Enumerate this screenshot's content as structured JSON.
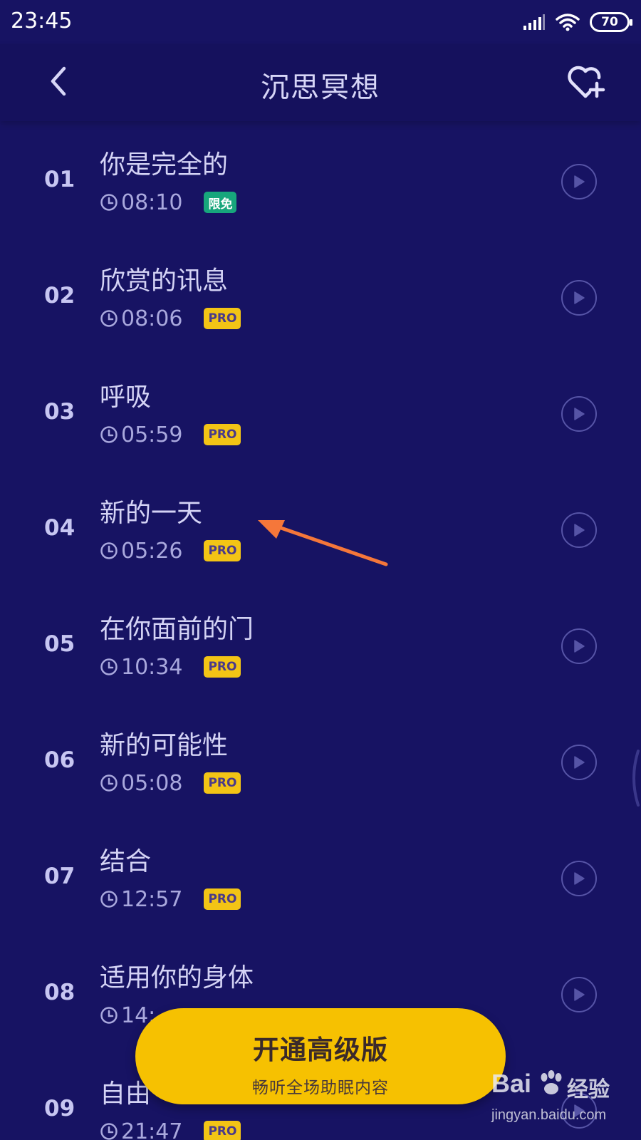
{
  "status_bar": {
    "time": "23:45",
    "battery": "70",
    "icons": [
      "signal-icon",
      "wifi-icon",
      "battery-icon"
    ]
  },
  "header": {
    "title": "沉思冥想",
    "back_icon": "chevron-left-icon",
    "favorite_icon": "heart-plus-icon"
  },
  "tracks": [
    {
      "num": "01",
      "title": "你是完全的",
      "duration": "08:10",
      "badge": "限免"
    },
    {
      "num": "02",
      "title": "欣赏的讯息",
      "duration": "08:06",
      "badge": "PRO"
    },
    {
      "num": "03",
      "title": "呼吸",
      "duration": "05:59",
      "badge": "PRO"
    },
    {
      "num": "04",
      "title": "新的一天",
      "duration": "05:26",
      "badge": "PRO"
    },
    {
      "num": "05",
      "title": "在你面前的门",
      "duration": "10:34",
      "badge": "PRO"
    },
    {
      "num": "06",
      "title": "新的可能性",
      "duration": "05:08",
      "badge": "PRO"
    },
    {
      "num": "07",
      "title": "结合",
      "duration": "12:57",
      "badge": "PRO"
    },
    {
      "num": "08",
      "title": "适用你的身体",
      "duration": "14:",
      "badge": ""
    },
    {
      "num": "09",
      "title": "自由",
      "duration": "21:47",
      "badge": "PRO"
    }
  ],
  "upgrade": {
    "title": "开通高级版",
    "subtitle": "畅听全场助眠内容"
  },
  "watermark": {
    "brand": "Bai",
    "brand_cn": "经验",
    "url": "jingyan.baidu.com"
  },
  "colors": {
    "background": "#171363",
    "header": "#15115d",
    "accent_yellow": "#f6c101",
    "badge_free": "#17a67c",
    "badge_pro": "#f3c415",
    "annotation_arrow": "#f5773a"
  }
}
